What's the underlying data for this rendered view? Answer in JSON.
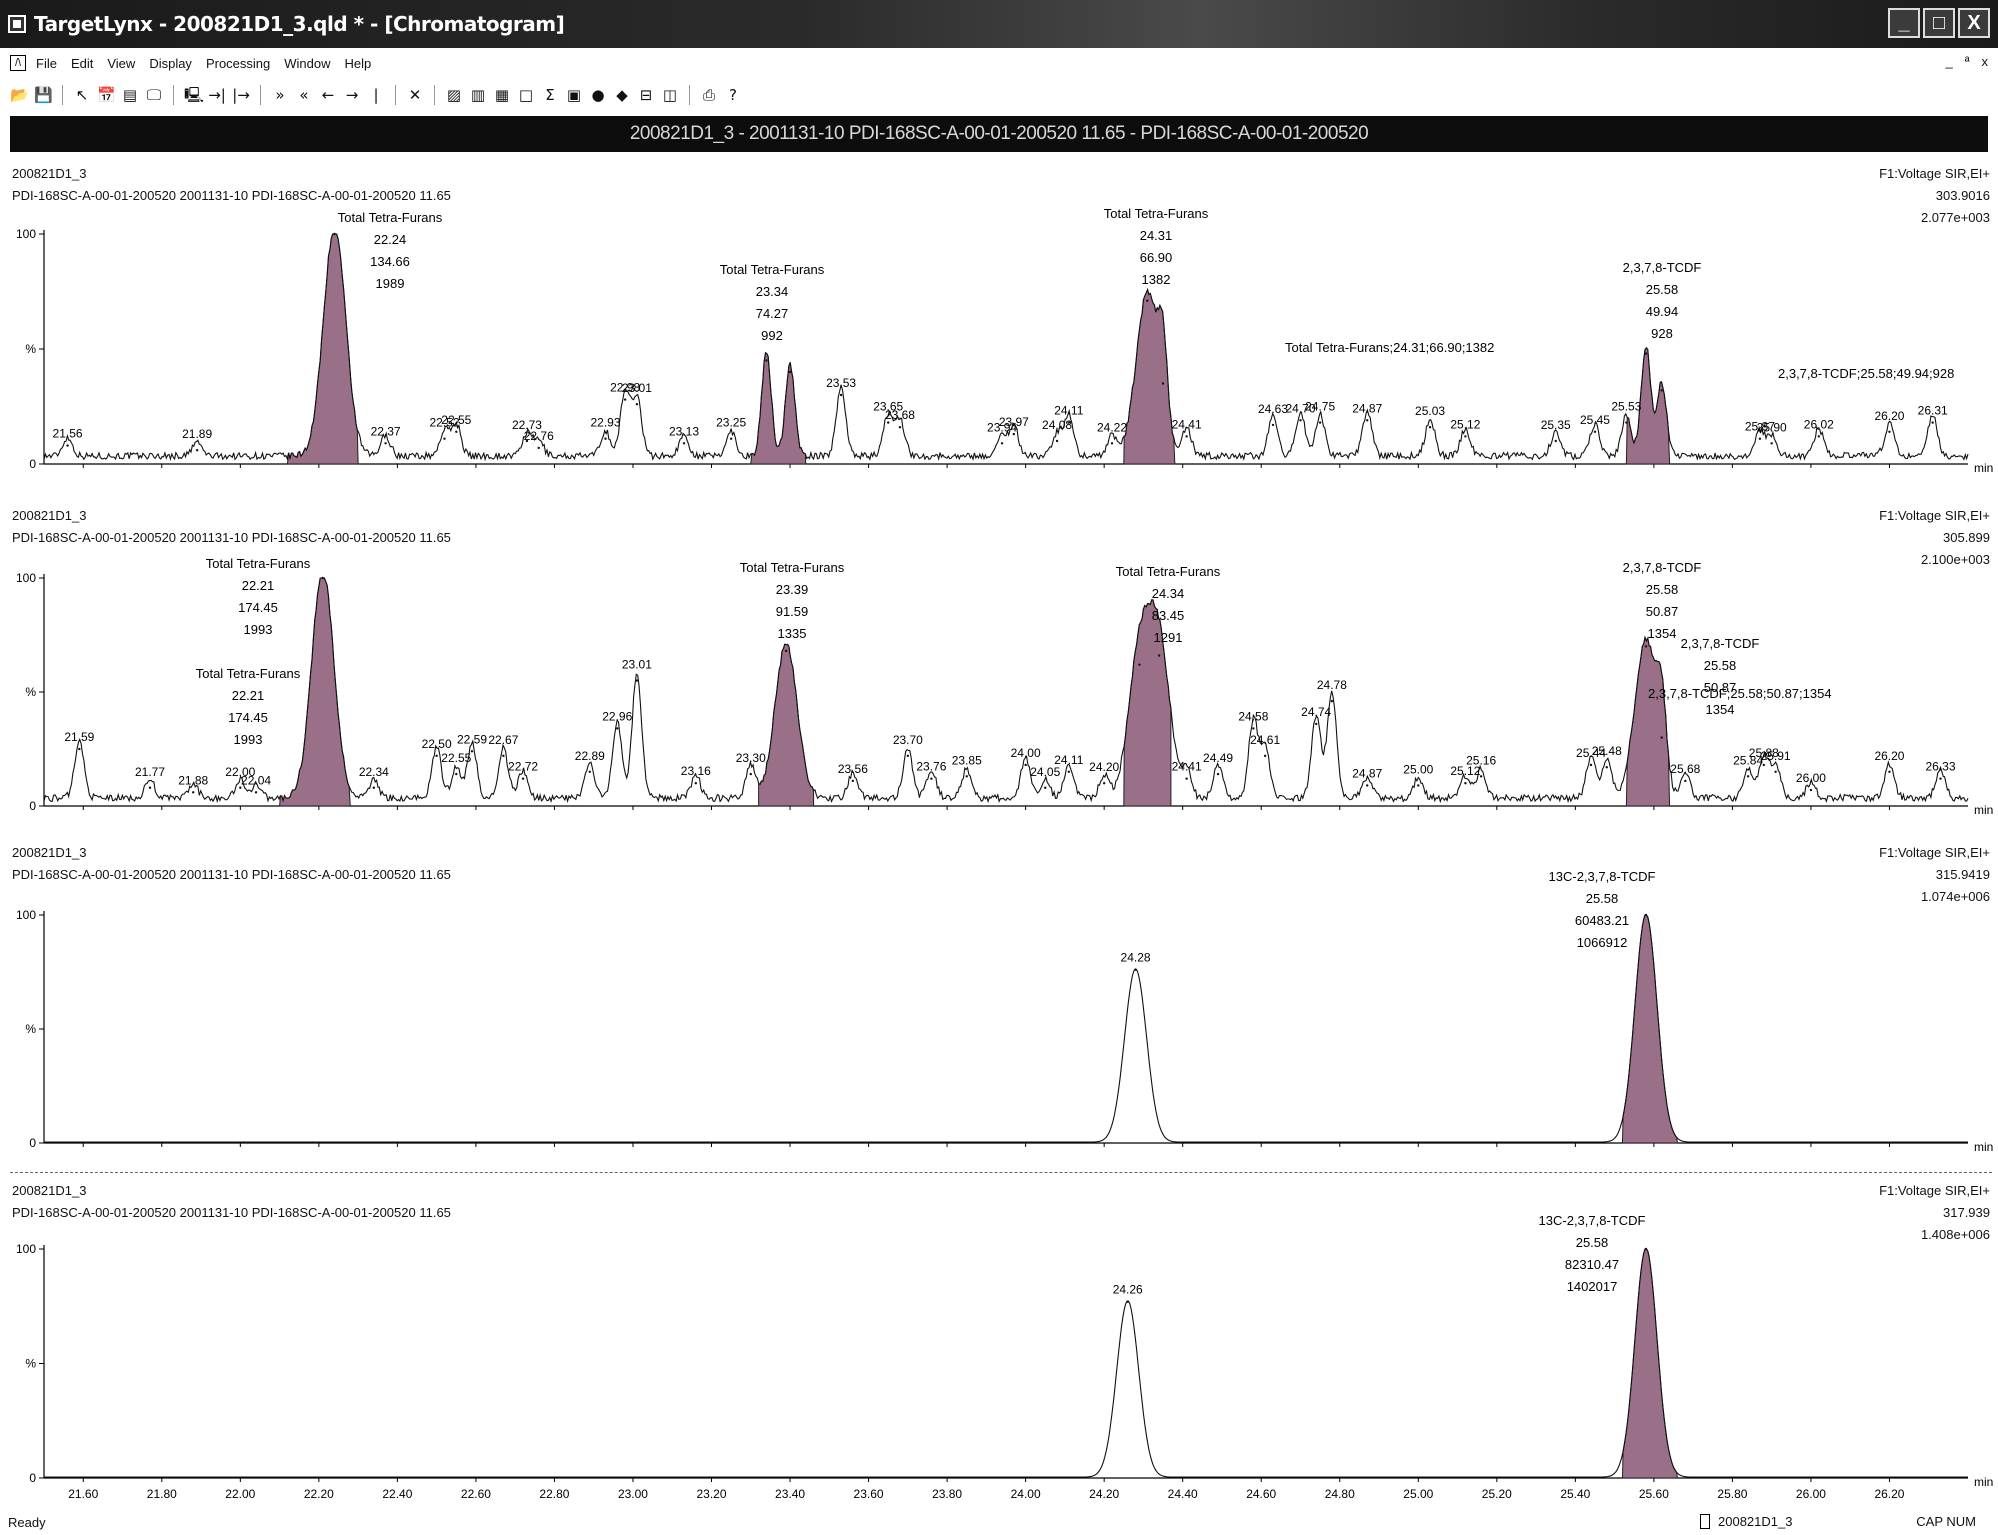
{
  "window": {
    "title": "TargetLynx - 200821D1_3.qld * - [Chromatogram]",
    "buttons": [
      "_",
      "□",
      "X"
    ]
  },
  "menu": {
    "items": [
      "File",
      "Edit",
      "View",
      "Display",
      "Processing",
      "Window",
      "Help"
    ],
    "mdi_controls": [
      "_",
      "ª",
      "x"
    ]
  },
  "toolbar": {
    "icons": [
      "open-icon",
      "save-icon",
      "pointer-icon",
      "calendar-icon",
      "list-icon",
      "print-preview-icon",
      "screen-icon",
      "zoom-in-icon",
      "zoom-out-icon",
      "range-icon",
      "range2-icon",
      "range3-icon",
      "pan-icon",
      "pan2-icon",
      "cross-icon",
      "chart-icon",
      "peak-icon",
      "bar-icon",
      "blank-icon",
      "sum-icon",
      "book-icon",
      "dot-icon",
      "pin-icon",
      "grid-icon",
      "window-icon",
      "printer-icon",
      "help-icon"
    ],
    "glyphs": [
      "📂",
      "💾",
      "↖",
      "📅",
      "▤",
      "🖵",
      "🖳",
      "→|",
      "|→",
      "»",
      "«",
      "←",
      "→",
      "|",
      "✕",
      "▨",
      "▥",
      "▦",
      "□",
      "Σ",
      "▣",
      "●",
      "◆",
      "⊟",
      "◫",
      "⎙",
      "?"
    ]
  },
  "header": {
    "text": "200821D1_3 - 2001131-10 PDI-168SC-A-00-01-200520 11.65 - PDI-168SC-A-00-01-200520"
  },
  "status": {
    "left": "Ready",
    "file": "200821D1_3",
    "keys": "CAP  NUM"
  },
  "chart_data": [
    {
      "type": "line",
      "sample": "200821D1_3",
      "description": "PDI-168SC-A-00-01-200520 2001131-10 PDI-168SC-A-00-01-200520 11.65",
      "function": "F1:Voltage SIR,EI+",
      "mass": "303.9016",
      "intensity": "2.077e+003",
      "xlim": [
        21.5,
        26.4
      ],
      "ylim": [
        0,
        100
      ],
      "x_unit": "min",
      "y_ticks": [
        "100",
        "%",
        "0"
      ],
      "peaks": [
        {
          "x": 21.56,
          "y": 8
        },
        {
          "x": 21.89,
          "y": 6
        },
        {
          "x": 22.24,
          "y": 100
        },
        {
          "x": 22.37,
          "y": 9
        },
        {
          "x": 22.52,
          "y": 11
        },
        {
          "x": 22.55,
          "y": 14
        },
        {
          "x": 22.73,
          "y": 10
        },
        {
          "x": 22.76,
          "y": 7
        },
        {
          "x": 22.93,
          "y": 11
        },
        {
          "x": 22.98,
          "y": 28
        },
        {
          "x": 23.01,
          "y": 26
        },
        {
          "x": 23.13,
          "y": 9
        },
        {
          "x": 23.25,
          "y": 11
        },
        {
          "x": 23.34,
          "y": 45
        },
        {
          "x": 23.4,
          "y": 40
        },
        {
          "x": 23.53,
          "y": 30
        },
        {
          "x": 23.65,
          "y": 18
        },
        {
          "x": 23.68,
          "y": 16
        },
        {
          "x": 23.94,
          "y": 9
        },
        {
          "x": 23.97,
          "y": 13
        },
        {
          "x": 24.08,
          "y": 10
        },
        {
          "x": 24.11,
          "y": 18
        },
        {
          "x": 24.22,
          "y": 9
        },
        {
          "x": 24.31,
          "y": 71
        },
        {
          "x": 24.35,
          "y": 35
        },
        {
          "x": 24.41,
          "y": 12
        },
        {
          "x": 24.63,
          "y": 17
        },
        {
          "x": 24.7,
          "y": 19
        },
        {
          "x": 24.75,
          "y": 18
        },
        {
          "x": 24.87,
          "y": 19
        },
        {
          "x": 25.03,
          "y": 16
        },
        {
          "x": 25.12,
          "y": 12
        },
        {
          "x": 25.35,
          "y": 10
        },
        {
          "x": 25.45,
          "y": 14
        },
        {
          "x": 25.53,
          "y": 18
        },
        {
          "x": 25.58,
          "y": 48
        },
        {
          "x": 25.62,
          "y": 32
        },
        {
          "x": 25.87,
          "y": 11
        },
        {
          "x": 25.9,
          "y": 9
        },
        {
          "x": 26.02,
          "y": 12
        },
        {
          "x": 26.2,
          "y": 14
        },
        {
          "x": 26.31,
          "y": 18
        }
      ],
      "filled": [
        {
          "from": 22.12,
          "to": 22.3,
          "peak": 22.24,
          "h": 100
        },
        {
          "from": 23.3,
          "to": 23.44,
          "peak": 23.34,
          "h": 45
        },
        {
          "from": 24.25,
          "to": 24.38,
          "peak": 24.31,
          "h": 71
        },
        {
          "from": 25.53,
          "to": 25.64,
          "peak": 25.58,
          "h": 48
        }
      ],
      "peak_labels": [
        "21.56",
        "21.89",
        "22.37",
        "22.52",
        "22.55",
        "22.73",
        "22.76",
        "22.93",
        "22.98",
        "23.01",
        "23.13",
        "23.25",
        "23.53",
        "23.65",
        "23.68",
        "23.94",
        "23.97",
        "24.08",
        "24.11",
        "24.22",
        "24.41",
        "24.63",
        "24.70",
        "24.75",
        "24.87",
        "25.03",
        "25.12",
        "25.35",
        "25.45",
        "25.53",
        "25.87",
        "25.90",
        "26.02",
        "26.20",
        "26.31"
      ],
      "annotations": [
        {
          "lines": [
            "Total Tetra-Furans",
            "22.24",
            "134.66",
            "1989"
          ]
        },
        {
          "lines": [
            "Total Tetra-Furans",
            "23.34",
            "74.27",
            "992"
          ]
        },
        {
          "lines": [
            "Total Tetra-Furans",
            "24.31",
            "66.90",
            "1382"
          ]
        },
        {
          "lines": [
            "Total Tetra-Furans;24.31;66.90;1382"
          ]
        },
        {
          "lines": [
            "2,3,7,8-TCDF",
            "25.58",
            "49.94",
            "928"
          ]
        },
        {
          "lines": [
            "2,3,7,8-TCDF;25.58;49.94;928"
          ]
        }
      ]
    },
    {
      "type": "line",
      "sample": "200821D1_3",
      "description": "PDI-168SC-A-00-01-200520 2001131-10 PDI-168SC-A-00-01-200520 11.65",
      "function": "F1:Voltage SIR,EI+",
      "mass": "305.899",
      "intensity": "2.100e+003",
      "xlim": [
        21.5,
        26.4
      ],
      "ylim": [
        0,
        100
      ],
      "x_unit": "min",
      "y_ticks": [
        "100",
        "%",
        "0"
      ],
      "peaks": [
        {
          "x": 21.59,
          "y": 25
        },
        {
          "x": 21.77,
          "y": 8
        },
        {
          "x": 21.88,
          "y": 6
        },
        {
          "x": 22.0,
          "y": 8
        },
        {
          "x": 22.04,
          "y": 6
        },
        {
          "x": 22.21,
          "y": 100
        },
        {
          "x": 22.34,
          "y": 8
        },
        {
          "x": 22.5,
          "y": 22
        },
        {
          "x": 22.55,
          "y": 14
        },
        {
          "x": 22.59,
          "y": 24
        },
        {
          "x": 22.67,
          "y": 22
        },
        {
          "x": 22.72,
          "y": 12
        },
        {
          "x": 22.89,
          "y": 15
        },
        {
          "x": 22.96,
          "y": 34
        },
        {
          "x": 23.01,
          "y": 55
        },
        {
          "x": 23.16,
          "y": 10
        },
        {
          "x": 23.3,
          "y": 14
        },
        {
          "x": 23.39,
          "y": 68
        },
        {
          "x": 23.56,
          "y": 11
        },
        {
          "x": 23.7,
          "y": 22
        },
        {
          "x": 23.76,
          "y": 12
        },
        {
          "x": 23.85,
          "y": 13
        },
        {
          "x": 24.0,
          "y": 18
        },
        {
          "x": 24.05,
          "y": 8
        },
        {
          "x": 24.11,
          "y": 15
        },
        {
          "x": 24.2,
          "y": 10
        },
        {
          "x": 24.29,
          "y": 62
        },
        {
          "x": 24.34,
          "y": 66
        },
        {
          "x": 24.41,
          "y": 12
        },
        {
          "x": 24.49,
          "y": 14
        },
        {
          "x": 24.58,
          "y": 34
        },
        {
          "x": 24.61,
          "y": 22
        },
        {
          "x": 24.74,
          "y": 36
        },
        {
          "x": 24.78,
          "y": 46
        },
        {
          "x": 24.87,
          "y": 9
        },
        {
          "x": 25.0,
          "y": 9
        },
        {
          "x": 25.12,
          "y": 10
        },
        {
          "x": 25.16,
          "y": 13
        },
        {
          "x": 25.44,
          "y": 18
        },
        {
          "x": 25.48,
          "y": 17
        },
        {
          "x": 25.58,
          "y": 70
        },
        {
          "x": 25.62,
          "y": 30
        },
        {
          "x": 25.68,
          "y": 11
        },
        {
          "x": 25.84,
          "y": 13
        },
        {
          "x": 25.88,
          "y": 18
        },
        {
          "x": 25.91,
          "y": 15
        },
        {
          "x": 26.0,
          "y": 7
        },
        {
          "x": 26.2,
          "y": 15
        },
        {
          "x": 26.33,
          "y": 12
        }
      ],
      "filled": [
        {
          "from": 22.1,
          "to": 22.28,
          "peak": 22.21,
          "h": 100
        },
        {
          "from": 23.32,
          "to": 23.46,
          "peak": 23.39,
          "h": 68
        },
        {
          "from": 24.25,
          "to": 24.37,
          "peak": 24.34,
          "h": 66
        },
        {
          "from": 25.53,
          "to": 25.64,
          "peak": 25.58,
          "h": 70
        }
      ],
      "peak_labels": [
        "21.59",
        "21.77",
        "21.88",
        "22.00",
        "22.04",
        "22.34",
        "22.50",
        "22.55",
        "22.59",
        "22.67",
        "22.72",
        "22.89",
        "22.96",
        "23.01",
        "23.16",
        "23.30",
        "23.56",
        "23.70",
        "23.76",
        "23.85",
        "24.00",
        "24.05",
        "24.11",
        "24.20",
        "24.41",
        "24.49",
        "24.58",
        "24.61",
        "24.74",
        "24.78",
        "24.87",
        "25.00",
        "25.12",
        "25.16",
        "25.44",
        "25.48",
        "25.68",
        "25.84",
        "25.88",
        "25.91",
        "26.00",
        "26.20",
        "26.33"
      ],
      "annotations": [
        {
          "lines": [
            "Total Tetra-Furans",
            "22.21",
            "174.45",
            "1993"
          ]
        },
        {
          "lines": [
            "Total Tetra-Furans",
            "22.21",
            "174.45",
            "1993"
          ]
        },
        {
          "lines": [
            "Total Tetra-Furans",
            "23.39",
            "91.59",
            "1335"
          ]
        },
        {
          "lines": [
            "Total Tetra-Furans",
            "24.34",
            "83.45",
            "1291"
          ]
        },
        {
          "lines": [
            "2,3,7,8-TCDF",
            "25.58",
            "50.87",
            "1354"
          ]
        },
        {
          "lines": [
            "2,3,7,8-TCDF",
            "25.58",
            "50.87",
            "1354"
          ]
        },
        {
          "lines": [
            "2,3,7,8-TCDF;25.58;50.87;1354"
          ]
        }
      ]
    },
    {
      "type": "line",
      "sample": "200821D1_3",
      "description": "PDI-168SC-A-00-01-200520 2001131-10 PDI-168SC-A-00-01-200520 11.65",
      "function": "F1:Voltage SIR,EI+",
      "mass": "315.9419",
      "intensity": "1.074e+006",
      "xlim": [
        21.5,
        26.4
      ],
      "ylim": [
        0,
        100
      ],
      "x_unit": "min",
      "y_ticks": [
        "100",
        "%",
        "0"
      ],
      "peaks": [
        {
          "x": 24.28,
          "y": 76
        },
        {
          "x": 25.58,
          "y": 100
        }
      ],
      "filled": [
        {
          "from": 25.52,
          "to": 25.66,
          "peak": 25.58,
          "h": 100
        }
      ],
      "peak_labels": [
        "24.28"
      ],
      "annotations": [
        {
          "lines": [
            "13C-2,3,7,8-TCDF",
            "25.58",
            "60483.21",
            "1066912"
          ]
        }
      ]
    },
    {
      "type": "line",
      "sample": "200821D1_3",
      "description": "PDI-168SC-A-00-01-200520 2001131-10 PDI-168SC-A-00-01-200520 11.65",
      "function": "F1:Voltage SIR,EI+",
      "mass": "317.939",
      "intensity": "1.408e+006",
      "xlim": [
        21.5,
        26.4
      ],
      "ylim": [
        0,
        100
      ],
      "x_unit": "min",
      "y_ticks": [
        "100",
        "%",
        "0"
      ],
      "x_ticks": [
        "21.60",
        "21.80",
        "22.00",
        "22.20",
        "22.40",
        "22.60",
        "22.80",
        "23.00",
        "23.20",
        "23.40",
        "23.60",
        "23.80",
        "24.00",
        "24.20",
        "24.40",
        "24.60",
        "24.80",
        "25.00",
        "25.20",
        "25.40",
        "25.60",
        "25.80",
        "26.00",
        "26.20"
      ],
      "peaks": [
        {
          "x": 24.26,
          "y": 77
        },
        {
          "x": 25.58,
          "y": 100
        }
      ],
      "filled": [
        {
          "from": 25.52,
          "to": 25.66,
          "peak": 25.58,
          "h": 100
        }
      ],
      "peak_labels": [
        "24.26"
      ],
      "annotations": [
        {
          "lines": [
            "13C-2,3,7,8-TCDF",
            "25.58",
            "82310.47",
            "1402017"
          ]
        }
      ]
    }
  ]
}
